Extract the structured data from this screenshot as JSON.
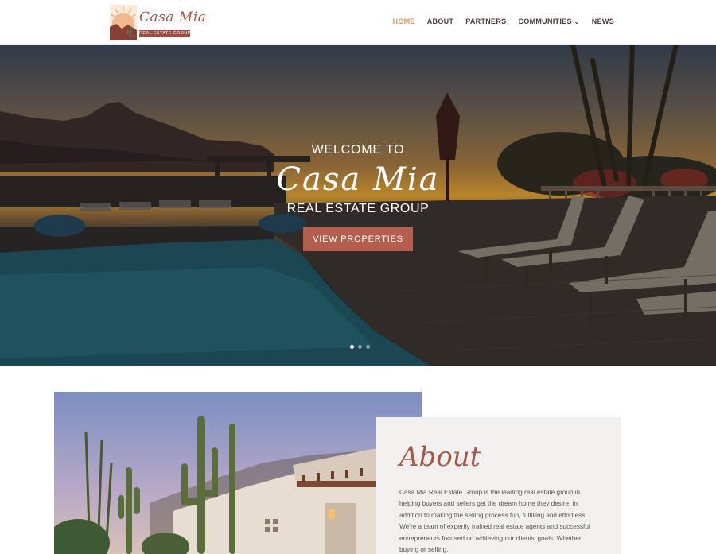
{
  "logo": {
    "script_text": "Casa Mia",
    "tagline": "REAL ESTATE GROUP",
    "sun_color": "#e9a06b",
    "brand_color": "#a4584a"
  },
  "nav": {
    "items": [
      {
        "label": "HOME",
        "active": true
      },
      {
        "label": "ABOUT",
        "active": false
      },
      {
        "label": "PARTNERS",
        "active": false
      },
      {
        "label": "COMMUNITIES",
        "active": false,
        "has_dropdown": true
      },
      {
        "label": "NEWS",
        "active": false
      }
    ],
    "active_color": "#d7955c"
  },
  "hero": {
    "welcome": "WELCOME TO",
    "script_title": "Casa Mia",
    "subtitle": "REAL ESTATE GROUP",
    "button_label": "VIEW PROPERTIES",
    "button_color": "#b55e4e",
    "slides": 3,
    "active_slide": 1
  },
  "about": {
    "heading": "About",
    "body": "Casa Mia Real Estate Group is the leading real estate group in helping buyers and sellers get the dream home they desire, in addition to making the selling process fun, fulfilling and effortless. We’re a team of expertly trained real estate agents and successful entrepreneurs focused on achieving our clients’ goals. Whether buying or selling,"
  },
  "icons": [
    "sun-logo-icon",
    "chevron-down-icon"
  ]
}
